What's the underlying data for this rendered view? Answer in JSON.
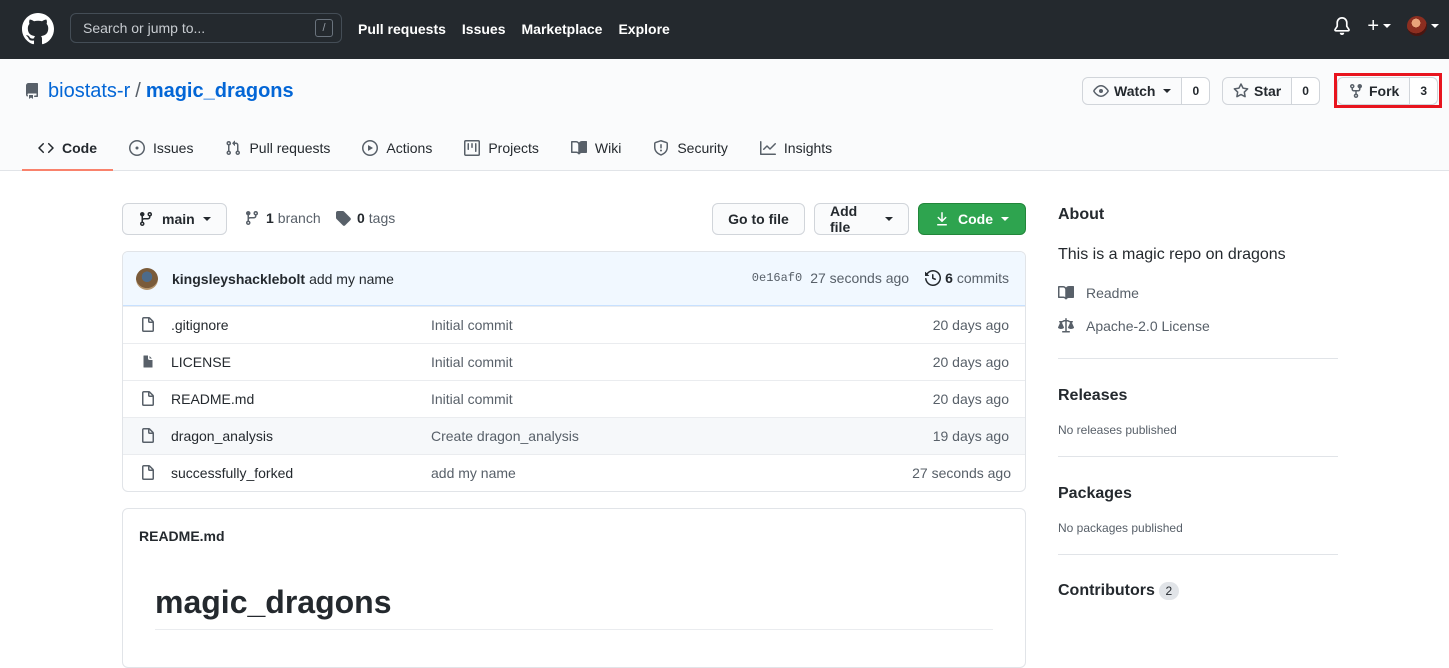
{
  "header": {
    "search_placeholder": "Search or jump to...",
    "search_key": "/",
    "nav": [
      "Pull requests",
      "Issues",
      "Marketplace",
      "Explore"
    ],
    "plus": "+"
  },
  "repo": {
    "owner": "biostats-r",
    "separator": "/",
    "name": "magic_dragons",
    "watch_label": "Watch",
    "watch_count": "0",
    "star_label": "Star",
    "star_count": "0",
    "fork_label": "Fork",
    "fork_count": "3"
  },
  "tabs": [
    "Code",
    "Issues",
    "Pull requests",
    "Actions",
    "Projects",
    "Wiki",
    "Security",
    "Insights"
  ],
  "toolbar": {
    "branch": "main",
    "branch_count": "1",
    "branch_label": "branch",
    "tag_count": "0",
    "tag_label": "tags",
    "go_to_file": "Go to file",
    "add_file": "Add file",
    "code": "Code"
  },
  "commit": {
    "author": "kingsleyshacklebolt",
    "message": "add my name",
    "sha": "0e16af0",
    "time": "27 seconds ago",
    "count": "6",
    "count_label": "commits"
  },
  "files": [
    {
      "name": ".gitignore",
      "message": "Initial commit",
      "age": "20 days ago"
    },
    {
      "name": "LICENSE",
      "message": "Initial commit",
      "age": "20 days ago"
    },
    {
      "name": "README.md",
      "message": "Initial commit",
      "age": "20 days ago"
    },
    {
      "name": "dragon_analysis",
      "message": "Create dragon_analysis",
      "age": "19 days ago"
    },
    {
      "name": "successfully_forked",
      "message": "add my name",
      "age": "27 seconds ago"
    }
  ],
  "readme": {
    "filename": "README.md",
    "heading": "magic_dragons"
  },
  "sidebar": {
    "about_title": "About",
    "description": "This is a magic repo on dragons",
    "readme_link": "Readme",
    "license_link": "Apache-2.0 License",
    "releases_title": "Releases",
    "releases_text": "No releases published",
    "packages_title": "Packages",
    "packages_text": "No packages published",
    "contributors_title": "Contributors",
    "contributors_count": "2"
  },
  "colors": {
    "header_bg": "#24292e",
    "link": "#0366d6",
    "code_button": "#2ea44f",
    "active_tab_underline": "#f9826c",
    "highlight_box": "#e8141e"
  }
}
